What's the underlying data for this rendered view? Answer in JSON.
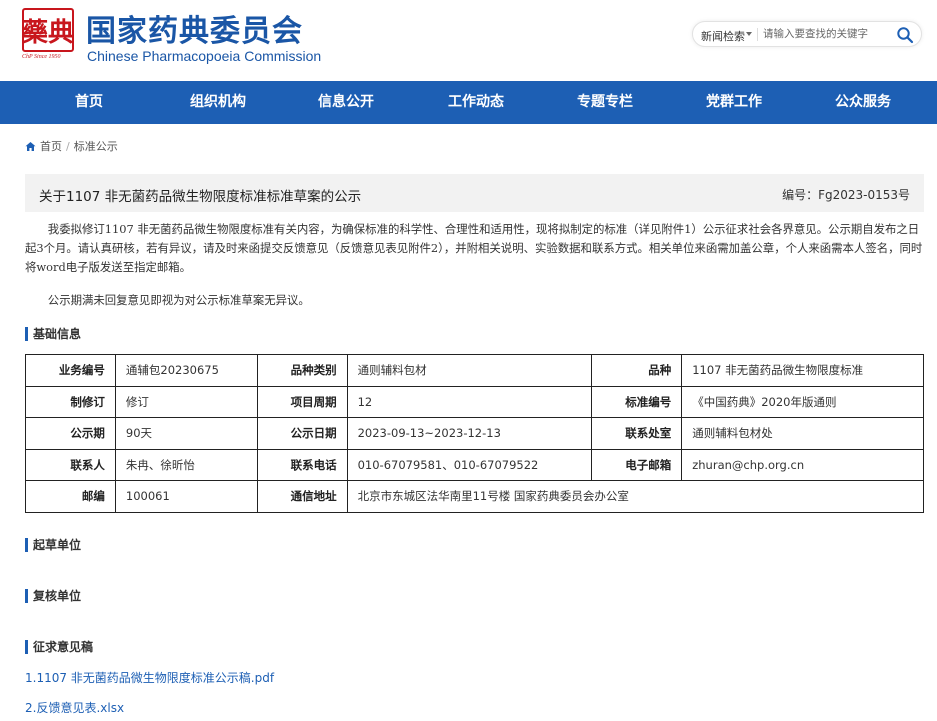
{
  "header": {
    "logo_glyph": "藥典",
    "logo_since": "ChP Since 1950",
    "site_name_cn": "国家药典委员会",
    "site_name_en": "Chinese Pharmacopoeia Commission"
  },
  "search": {
    "category": "新闻检索",
    "placeholder": "请输入要查找的关键字"
  },
  "nav": {
    "items": [
      "首页",
      "组织机构",
      "信息公开",
      "工作动态",
      "专题专栏",
      "党群工作",
      "公众服务"
    ]
  },
  "breadcrumb": {
    "home": "首页",
    "current": "标准公示"
  },
  "article": {
    "title": "关于1107 非无菌药品微生物限度标准标准草案的公示",
    "code": "编号：Fg2023-0153号",
    "paragraph1": "我委拟修订1107 非无菌药品微生物限度标准有关内容，为确保标准的科学性、合理性和适用性，现将拟制定的标准（详见附件1）公示征求社会各界意见。公示期自发布之日起3个月。请认真研核，若有异议，请及时来函提交反馈意见（反馈意见表见附件2），并附相关说明、实验数据和联系方式。相关单位来函需加盖公章，个人来函需本人签名，同时将word电子版发送至指定邮箱。",
    "paragraph2": "公示期满未回复意见即视为对公示标准草案无异议。"
  },
  "sections": {
    "basic": "基础信息",
    "drafter": "起草单位",
    "reviewer": "复核单位",
    "drafts": "征求意见稿"
  },
  "info_table": {
    "rows": [
      [
        {
          "k": "业务编号",
          "v": "通辅包20230675"
        },
        {
          "k": "品种类别",
          "v": "通则辅料包材"
        },
        {
          "k": "品种",
          "v": "1107 非无菌药品微生物限度标准"
        }
      ],
      [
        {
          "k": "制修订",
          "v": "修订"
        },
        {
          "k": "项目周期",
          "v": "12"
        },
        {
          "k": "标准编号",
          "v": "《中国药典》2020年版通则"
        }
      ],
      [
        {
          "k": "公示期",
          "v": "90天"
        },
        {
          "k": "公示日期",
          "v": "2023-09-13~2023-12-13"
        },
        {
          "k": "联系处室",
          "v": "通则辅料包材处"
        }
      ],
      [
        {
          "k": "联系人",
          "v": "朱冉、徐昕怡"
        },
        {
          "k": "联系电话",
          "v": "010-67079581、010-67079522"
        },
        {
          "k": "电子邮箱",
          "v": "zhuran@chp.org.cn"
        }
      ],
      [
        {
          "k": "邮编",
          "v": "100061"
        },
        {
          "k": "通信地址",
          "v": "北京市东城区法华南里11号楼 国家药典委员会办公室"
        }
      ]
    ]
  },
  "attachments": [
    "1.1107 非无菌药品微生物限度标准公示稿.pdf",
    "2.反馈意见表.xlsx"
  ],
  "colors": {
    "brand_blue": "#1d5fb4",
    "seal_red": "#c8161d"
  }
}
